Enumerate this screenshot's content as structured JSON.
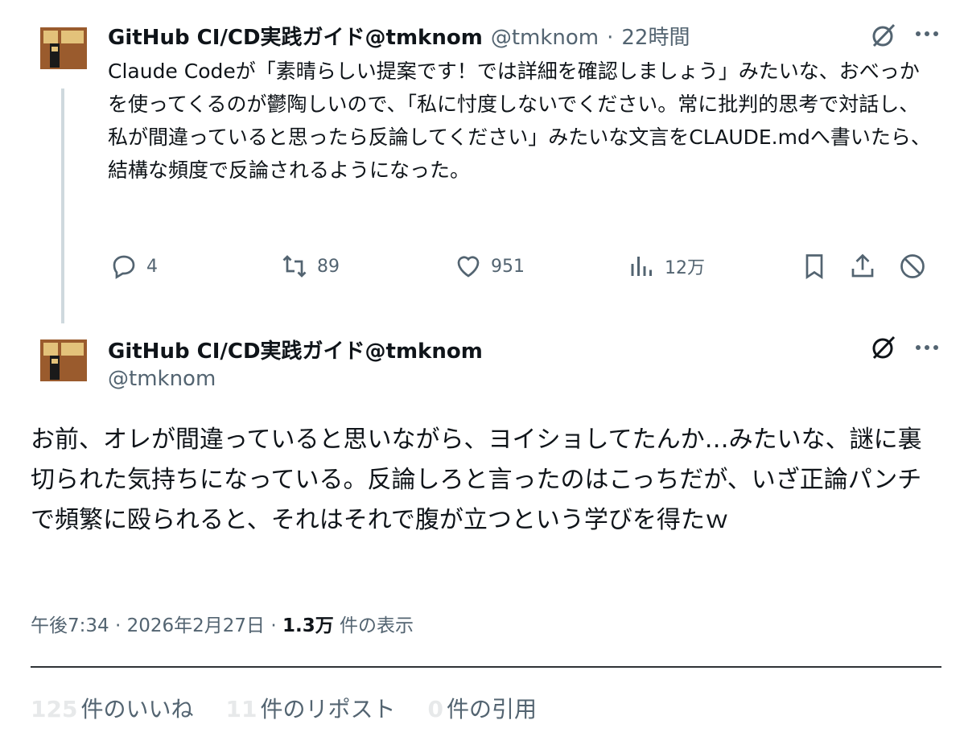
{
  "tweet1": {
    "author_name": "GitHub CI/CD実践ガイド@tmknom",
    "author_handle": "@tmknom",
    "time_sep": "·",
    "time": "22時間",
    "text": "Claude Codeが「素晴らしい提案です！では詳細を確認しましょう」みたいな、おべっかを使ってくるのが鬱陶しいので、「私に忖度しないでください。常に批判的思考で対話し、私が間違っていると思ったら反論してください」みたいな文言をCLAUDE.mdへ書いたら、結構な頻度で反論されるようになった。",
    "replies": "4",
    "reposts": "89",
    "likes": "951",
    "views": "12万"
  },
  "tweet2": {
    "author_name": "GitHub CI/CD実践ガイド@tmknom",
    "author_handle": "@tmknom",
    "text": "お前、オレが間違っていると思いながら、ヨイショしてたんか…みたいな、謎に裏切られた気持ちになっている。反論しろと言ったのはこっちだが、いざ正論パンチで頻繁に殴られると、それはそれで腹が立つという学びを得たｗ",
    "time": "午後7:34",
    "date": "2026年2月27日",
    "sep": "·",
    "views": "1.3万",
    "views_label": "件の表示"
  },
  "stats": {
    "likes_count": "125",
    "likes_label": "件のいいね",
    "reposts_count": "11",
    "reposts_label": "件のリポスト",
    "quotes_count": "0",
    "quotes_label": "件の引用"
  },
  "colors": {
    "text": "#0f1419",
    "secondary": "#536471",
    "line": "#cfd9de",
    "avatar_brown": "#9a5b2d",
    "avatar_tan": "#e3c27a"
  },
  "icons": [
    "grok-icon",
    "more-icon",
    "reply-icon",
    "repost-icon",
    "like-icon",
    "views-icon",
    "bookmark-icon",
    "share-icon",
    "mute-icon"
  ]
}
